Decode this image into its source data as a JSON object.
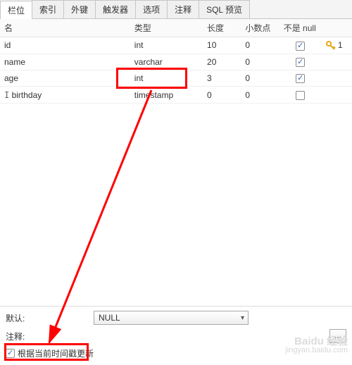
{
  "tabs": {
    "t0": "栏位",
    "t1": "索引",
    "t2": "外键",
    "t3": "触发器",
    "t4": "选项",
    "t5": "注释",
    "t6": "SQL 预览"
  },
  "headers": {
    "name": "名",
    "type": "类型",
    "length": "长度",
    "decimal": "小数点",
    "notnull": "不是 null"
  },
  "rows": {
    "r0": {
      "name": "id",
      "type": "int",
      "len": "10",
      "dec": "0",
      "key": "1"
    },
    "r1": {
      "name": "name",
      "type": "varchar",
      "len": "20",
      "dec": "0"
    },
    "r2": {
      "name": "age",
      "type": "int",
      "len": "3",
      "dec": "0"
    },
    "r3": {
      "name": "birthday",
      "type": "timestamp",
      "len": "0",
      "dec": "0"
    }
  },
  "bottom": {
    "default_label": "默认:",
    "comment_label": "注释:",
    "default_value": "NULL",
    "update_ts_label": "根据当前时间戳更新"
  },
  "watermark": {
    "brand": "Baidu 经验",
    "url": "jingyan.baidu.com"
  }
}
